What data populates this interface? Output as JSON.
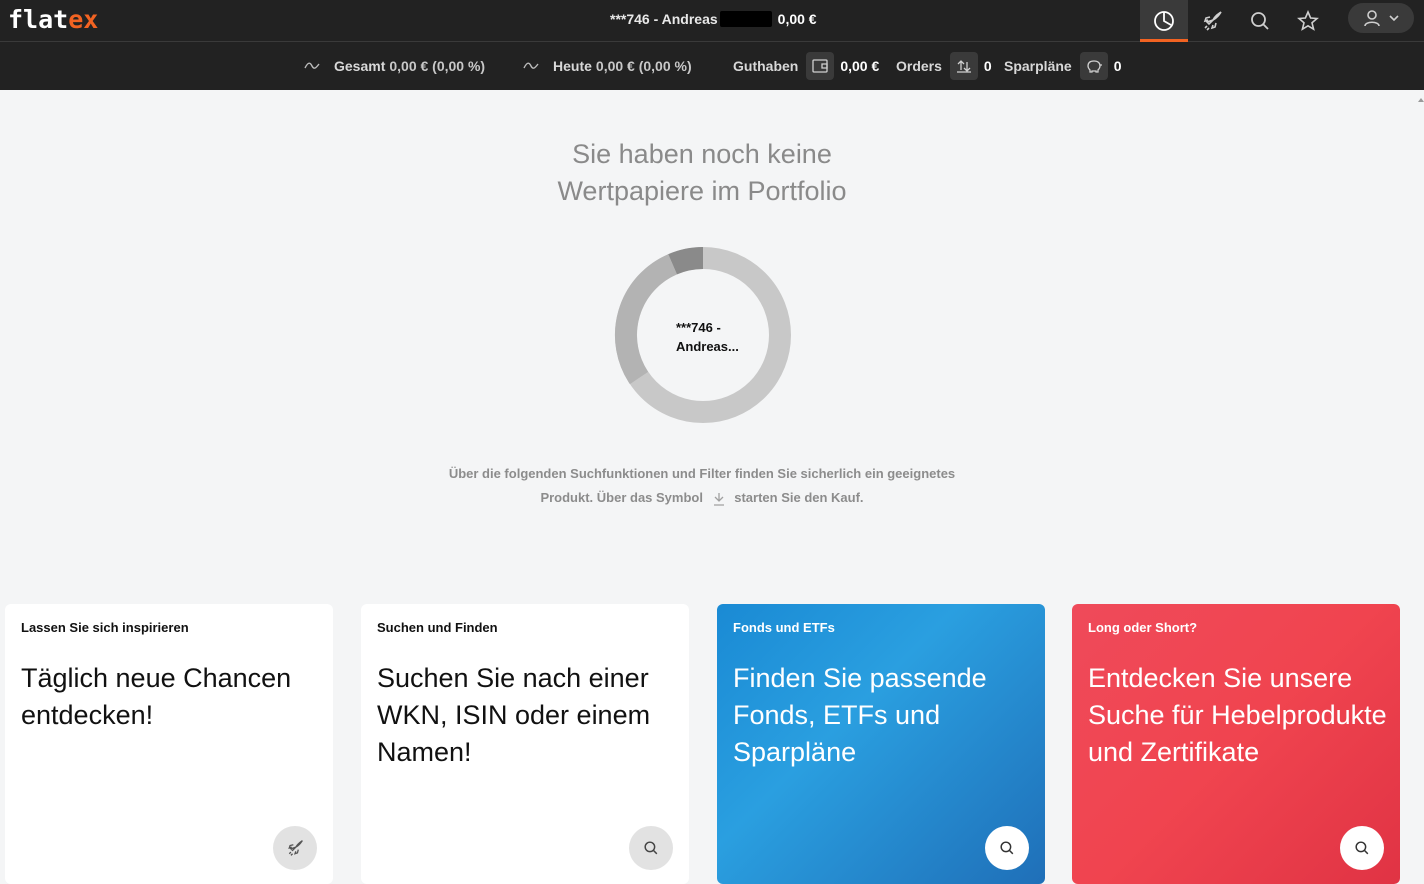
{
  "logo": {
    "part1": "flat",
    "part2": "ex"
  },
  "header": {
    "account": "***746 - Andreas",
    "balance": "0,00 €",
    "nav": [
      "portfolio-icon",
      "rocket-icon",
      "search-icon",
      "star-icon"
    ],
    "user_icon": "user-icon"
  },
  "stats": {
    "gesamt_label": "Gesamt",
    "gesamt_value": "0,00 € (0,00 %)",
    "heute_label": "Heute",
    "heute_value": "0,00 € (0,00 %)",
    "guthaben_label": "Guthaben",
    "guthaben_value": "0,00 €",
    "orders_label": "Orders",
    "orders_value": "0",
    "sparplaene_label": "Sparpläne",
    "sparplaene_value": "0"
  },
  "main": {
    "headline_line1": "Sie haben noch keine",
    "headline_line2": "Wertpapiere im Portfolio",
    "donut_label_line1": "***746 -",
    "donut_label_line2": "Andreas...",
    "info_line1": "Über die folgenden Suchfunktionen und Filter finden Sie sicherlich ein geeignetes",
    "info_line2a": "Produkt. Über das Symbol",
    "info_line2b": "starten Sie den Kauf."
  },
  "cards": [
    {
      "title": "Lassen Sie sich inspirieren",
      "body": "Täglich neue Chancen entdecken!",
      "icon": "rocket-icon"
    },
    {
      "title": "Suchen und Finden",
      "body": "Suchen Sie nach einer WKN, ISIN oder einem Namen!",
      "icon": "search-icon"
    },
    {
      "title": "Fonds und ETFs",
      "body": "Finden Sie passende Fonds, ETFs und Sparpläne",
      "icon": "search-icon"
    },
    {
      "title": "Long oder Short?",
      "body": "Entdecken Sie unsere Suche für Hebelprodukte und Zertifikate",
      "icon": "search-icon"
    }
  ],
  "colors": {
    "accent": "#f26322",
    "topbar": "#222222",
    "card_blue": "#2a9fe0",
    "card_red": "#f0444f"
  }
}
